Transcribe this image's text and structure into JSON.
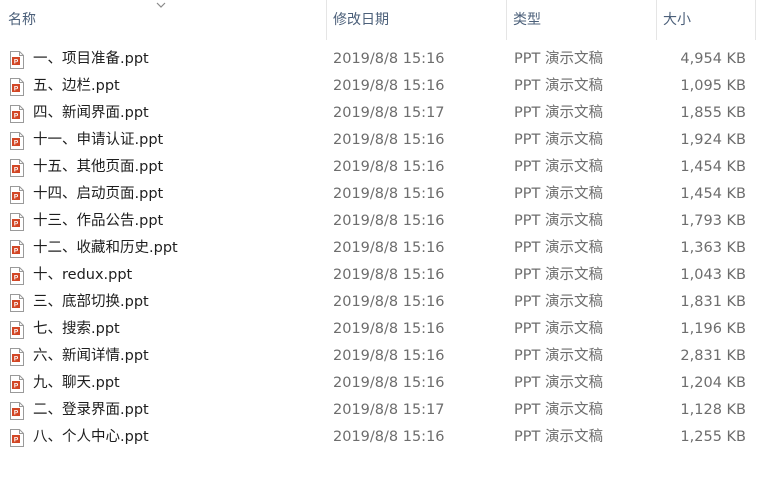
{
  "columns": {
    "name": "名称",
    "modified": "修改日期",
    "type": "类型",
    "size": "大小"
  },
  "icons": {
    "sort": "sort-descending-icon",
    "file": "ppt-file-icon"
  },
  "colors": {
    "header_text": "#4c607a",
    "name_text": "#1e1e1e",
    "meta_text": "#6d6d6d",
    "ppt_accent": "#d24726"
  },
  "files": [
    {
      "name": "一、项目准备.ppt",
      "modified": "2019/8/8 15:16",
      "type": "PPT 演示文稿",
      "size": "4,954 KB"
    },
    {
      "name": "五、边栏.ppt",
      "modified": "2019/8/8 15:16",
      "type": "PPT 演示文稿",
      "size": "1,095 KB"
    },
    {
      "name": "四、新闻界面.ppt",
      "modified": "2019/8/8 15:17",
      "type": "PPT 演示文稿",
      "size": "1,855 KB"
    },
    {
      "name": "十一、申请认证.ppt",
      "modified": "2019/8/8 15:16",
      "type": "PPT 演示文稿",
      "size": "1,924 KB"
    },
    {
      "name": "十五、其他页面.ppt",
      "modified": "2019/8/8 15:16",
      "type": "PPT 演示文稿",
      "size": "1,454 KB"
    },
    {
      "name": "十四、启动页面.ppt",
      "modified": "2019/8/8 15:16",
      "type": "PPT 演示文稿",
      "size": "1,454 KB"
    },
    {
      "name": "十三、作品公告.ppt",
      "modified": "2019/8/8 15:16",
      "type": "PPT 演示文稿",
      "size": "1,793 KB"
    },
    {
      "name": "十二、收藏和历史.ppt",
      "modified": "2019/8/8 15:16",
      "type": "PPT 演示文稿",
      "size": "1,363 KB"
    },
    {
      "name": "十、redux.ppt",
      "modified": "2019/8/8 15:16",
      "type": "PPT 演示文稿",
      "size": "1,043 KB"
    },
    {
      "name": "三、底部切换.ppt",
      "modified": "2019/8/8 15:16",
      "type": "PPT 演示文稿",
      "size": "1,831 KB"
    },
    {
      "name": "七、搜索.ppt",
      "modified": "2019/8/8 15:16",
      "type": "PPT 演示文稿",
      "size": "1,196 KB"
    },
    {
      "name": "六、新闻详情.ppt",
      "modified": "2019/8/8 15:16",
      "type": "PPT 演示文稿",
      "size": "2,831 KB"
    },
    {
      "name": "九、聊天.ppt",
      "modified": "2019/8/8 15:16",
      "type": "PPT 演示文稿",
      "size": "1,204 KB"
    },
    {
      "name": "二、登录界面.ppt",
      "modified": "2019/8/8 15:17",
      "type": "PPT 演示文稿",
      "size": "1,128 KB"
    },
    {
      "name": "八、个人中心.ppt",
      "modified": "2019/8/8 15:16",
      "type": "PPT 演示文稿",
      "size": "1,255 KB"
    }
  ]
}
